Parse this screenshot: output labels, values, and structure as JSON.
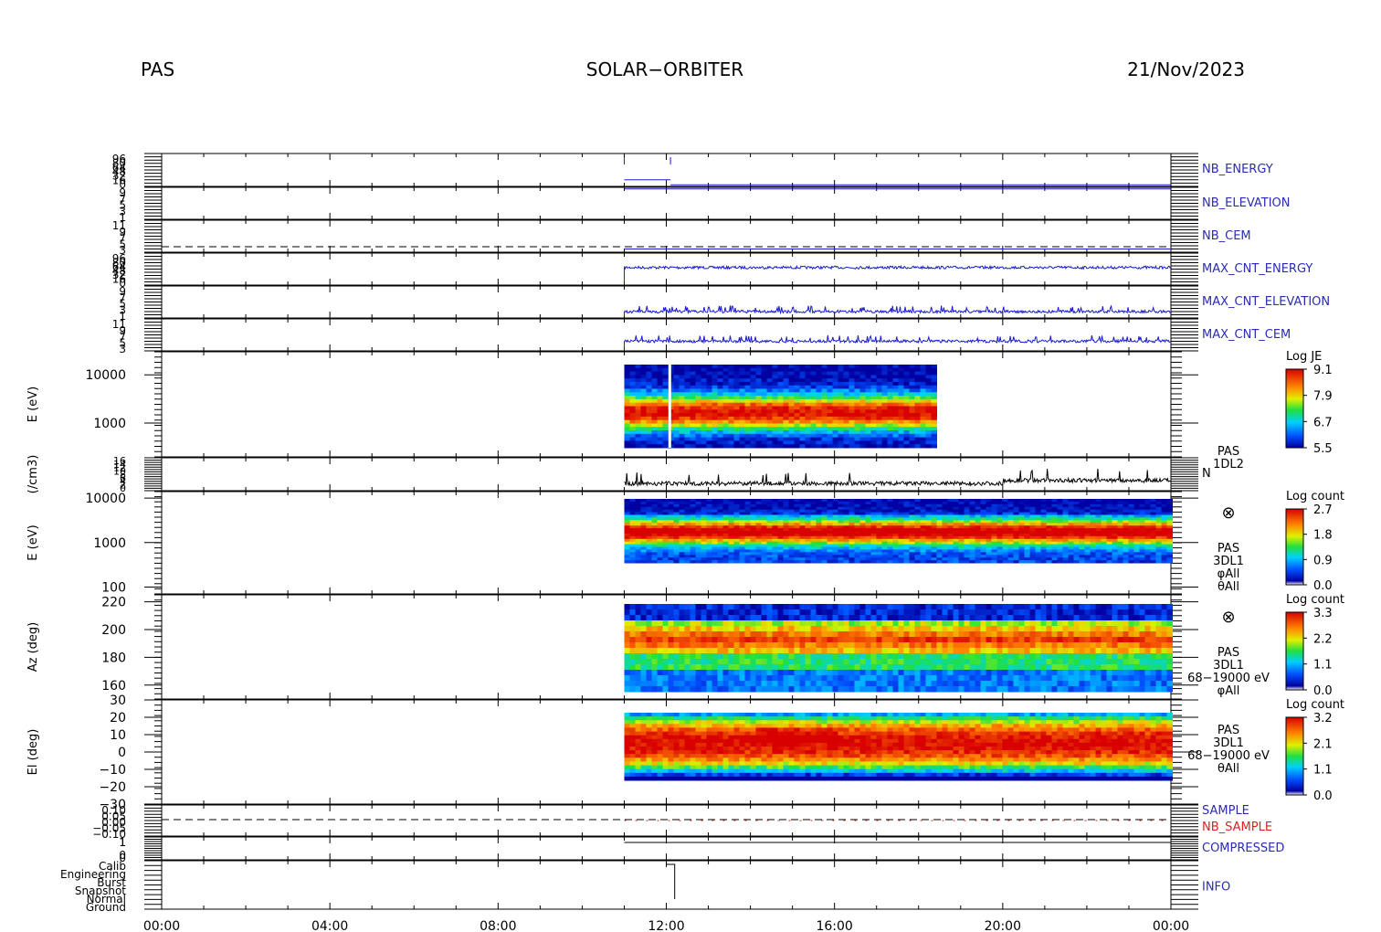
{
  "header": {
    "instrument": "PAS",
    "mission": "SOLAR−ORBITER",
    "date": "21/Nov/2023"
  },
  "colors": {
    "hk_label": "#2b2bb5",
    "hk_trace": "#1a1ad0",
    "nb_sample": "#e02020",
    "frame": "#000000",
    "density_trace": "#000000"
  },
  "chart_data": {
    "type": "heatmap",
    "x_axis": {
      "range_hours": [
        0,
        24
      ],
      "tick_hours": [
        0,
        4,
        8,
        12,
        16,
        20,
        24
      ],
      "tick_labels": [
        "00:00",
        "04:00",
        "08:00",
        "12:00",
        "16:00",
        "20:00",
        "00:00"
      ]
    },
    "data_coverage_hours": [
      11.0,
      24.0
    ],
    "panels": [
      {
        "id": "nb-energy",
        "label": "NB_ENERGY",
        "tick_labels": [
          "96",
          "80",
          "64",
          "48",
          "32",
          "16",
          "0"
        ],
        "segments": [
          {
            "from": 11.0,
            "to": 12.1,
            "level": 0.2
          },
          {
            "from": 12.1,
            "to": 24.0,
            "level": 0.05
          }
        ]
      },
      {
        "id": "nb-elevation",
        "label": "NB_ELEVATION",
        "tick_labels": [
          "9",
          "7",
          "5",
          "3",
          "1"
        ],
        "segments": [
          {
            "from": 11.0,
            "to": 24.0,
            "level": 0.95
          }
        ]
      },
      {
        "id": "nb-cem",
        "label": "NB_CEM",
        "tick_labels": [
          "11",
          "9",
          "7",
          "5",
          "3"
        ],
        "segments": [
          {
            "from": 11.0,
            "to": 24.0,
            "level": 0.1
          }
        ]
      },
      {
        "id": "max-cnt-energy",
        "label": "MAX_CNT_ENERGY",
        "tick_labels": [
          "96",
          "80",
          "64",
          "48",
          "32",
          "16",
          "0"
        ],
        "trace": {
          "from": 11.0,
          "to": 24.0,
          "level": 0.55
        }
      },
      {
        "id": "max-cnt-elevation",
        "label": "MAX_CNT_ELEVATION",
        "tick_labels": [
          "9",
          "7",
          "5",
          "3",
          "1"
        ],
        "trace": {
          "from": 11.0,
          "to": 24.0,
          "level": 0.2
        }
      },
      {
        "id": "max-cnt-cem",
        "label": "MAX_CNT_CEM",
        "tick_labels": [
          "11",
          "9",
          "7",
          "5",
          "3"
        ],
        "trace": {
          "from": 11.0,
          "to": 24.0,
          "level": 0.3
        }
      },
      {
        "id": "l2-energy",
        "ylabel": "E (eV)",
        "y_range": [
          200,
          30000
        ],
        "y_scale": "log",
        "tick_values": [
          1000,
          10000
        ],
        "tick_labels": [
          "1000",
          "10000"
        ],
        "data_hours": [
          11.0,
          18.3
        ],
        "peak_energy_ev": 1400,
        "colorbar": {
          "title": "Log JE",
          "min": 5.5,
          "max": 9.1,
          "tick_labels": [
            "9.1",
            "7.9",
            "6.7",
            "5.5"
          ]
        }
      },
      {
        "id": "density",
        "ylabel": "(/cm3)",
        "label": "N",
        "tag_lines": [
          "PAS",
          "1DL2"
        ],
        "tick_labels": [
          "16",
          "14",
          "12",
          "10",
          "8",
          "6",
          "4",
          "2",
          "0"
        ],
        "y_range": [
          0,
          16
        ],
        "trace": {
          "from": 11.0,
          "to": 24.0,
          "mean": 3.5
        }
      },
      {
        "id": "l1-energy",
        "ylabel": "E (eV)",
        "y_range": [
          70,
          14000
        ],
        "y_scale": "log",
        "tick_values": [
          100,
          1000,
          10000
        ],
        "tick_labels": [
          "100",
          "1000",
          "10000"
        ],
        "data_hours": [
          11.0,
          24.0
        ],
        "peak_energy_ev": 1200,
        "tag_lines": [
          "PAS",
          "3DL1",
          "φAll",
          "θAll"
        ],
        "colorbar": {
          "title": "Log count",
          "min": 0.0,
          "max": 2.7,
          "tick_labels": [
            "2.7",
            "1.8",
            "0.9",
            "0.0"
          ]
        }
      },
      {
        "id": "l1-azimuth",
        "ylabel": "Az (deg)",
        "y_range": [
          150,
          225
        ],
        "tick_values": [
          160,
          180,
          200,
          220
        ],
        "tick_labels": [
          "160",
          "180",
          "200",
          "220"
        ],
        "data_hours": [
          11.0,
          24.0
        ],
        "tag_lines": [
          "PAS",
          "3DL1",
          "68−19000 eV",
          "φAll"
        ],
        "colorbar": {
          "title": "Log count",
          "min": 0.0,
          "max": 3.3,
          "tick_labels": [
            "3.3",
            "2.2",
            "1.1",
            "0.0"
          ]
        }
      },
      {
        "id": "l1-elevation",
        "ylabel": "El (deg)",
        "y_range": [
          -30,
          30
        ],
        "tick_values": [
          -30,
          -20,
          -10,
          0,
          10,
          20,
          30
        ],
        "tick_labels": [
          "−30",
          "−20",
          "−10",
          "0",
          "10",
          "20",
          "30"
        ],
        "data_hours": [
          11.0,
          24.0
        ],
        "tag_lines": [
          "PAS",
          "3DL1",
          "68−19000 eV",
          "θAll"
        ],
        "colorbar": {
          "title": "Log count",
          "min": 0.0,
          "max": 3.2,
          "tick_labels": [
            "3.2",
            "2.1",
            "1.1",
            "0.0"
          ]
        }
      },
      {
        "id": "sample",
        "label": "SAMPLE",
        "label2": "NB_SAMPLE",
        "tick_labels": [
          "0.10",
          "0.05",
          "0.00",
          "−0.05",
          "−0.10"
        ]
      },
      {
        "id": "compressed",
        "label": "COMPRESSED",
        "tick_labels": [
          "1",
          "0"
        ]
      },
      {
        "id": "info",
        "label": "INFO",
        "tick_labels": [
          "Calib",
          "Engineering",
          "Burst",
          "Snapshot",
          "Normal",
          "Ground"
        ]
      }
    ]
  }
}
